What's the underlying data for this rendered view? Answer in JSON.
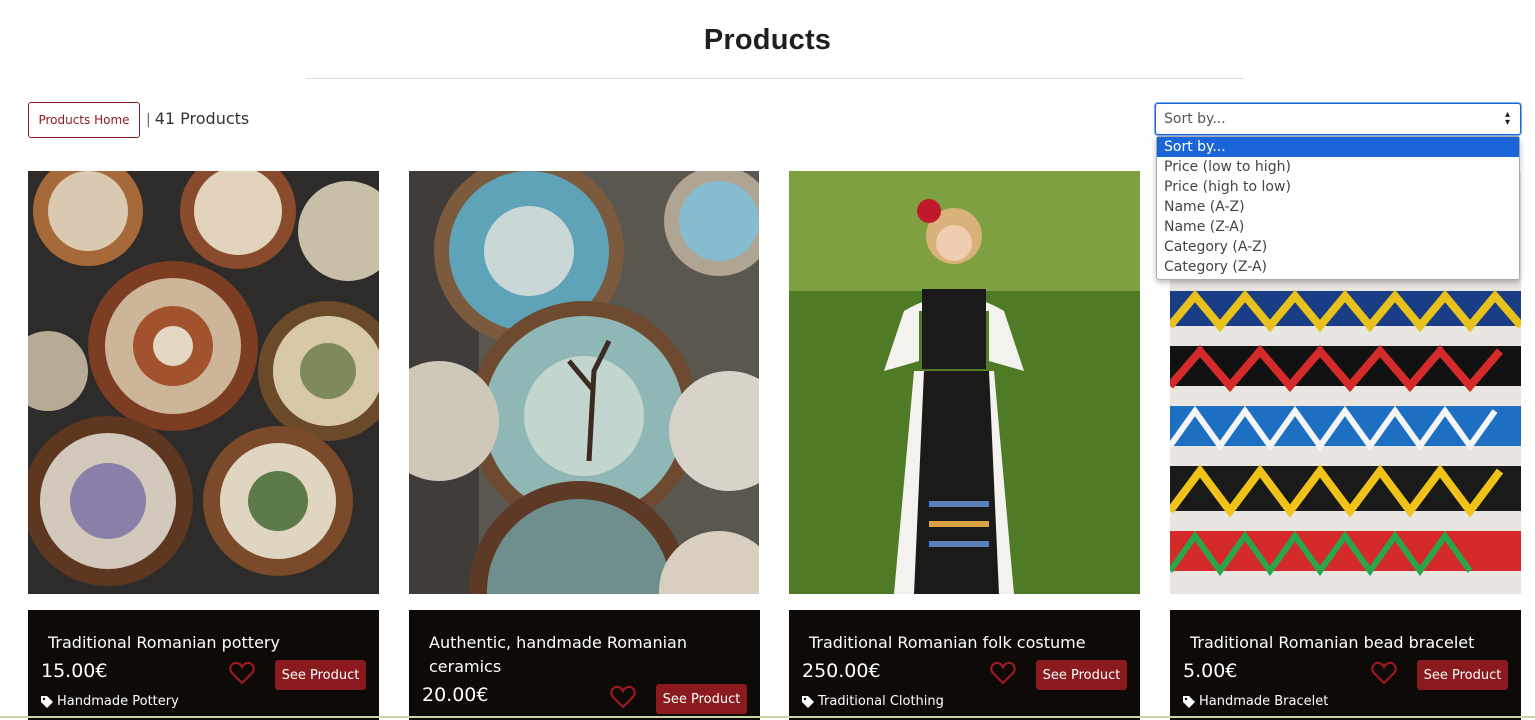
{
  "page": {
    "title": "Products"
  },
  "toolbar": {
    "home_label": "Products Home",
    "separator": "|",
    "count_label": "41 Products"
  },
  "sort": {
    "selected": "Sort by...",
    "options": [
      "Sort by...",
      "Price (low to high)",
      "Price (high to low)",
      "Name (A-Z)",
      "Name (Z-A)",
      "Category (A-Z)",
      "Category (Z-A)"
    ]
  },
  "products": [
    {
      "name": "Traditional Romanian pottery",
      "price": "15.00€",
      "category": "Handmade Pottery",
      "button": "See Product",
      "icon": "heart-outline-icon"
    },
    {
      "name": "Authentic, handmade Romanian ceramics",
      "price": "20.00€",
      "category": "",
      "button": "See Product",
      "icon": "heart-outline-icon"
    },
    {
      "name": "Traditional Romanian folk costume",
      "price": "250.00€",
      "category": "Traditional Clothing",
      "button": "See Product",
      "icon": "heart-outline-icon"
    },
    {
      "name": "Traditional Romanian bead bracelet",
      "price": "5.00€",
      "category": "Handmade Bracelet",
      "button": "See Product",
      "icon": "heart-outline-icon"
    }
  ],
  "colors": {
    "brand": "#8b1a1e",
    "card_body": "#0d0a08",
    "focus": "#1a66d8"
  }
}
